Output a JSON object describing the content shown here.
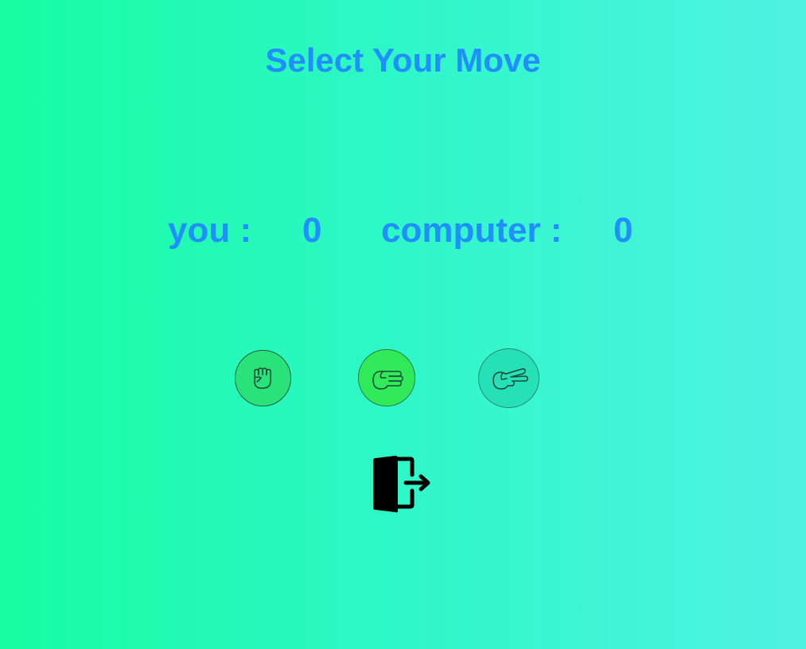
{
  "header": {
    "title": "Select Your Move"
  },
  "score": {
    "you_label": "you :",
    "you_value": "0",
    "computer_label": "computer :",
    "computer_value": "0"
  },
  "moves": [
    {
      "name": "rock",
      "icon": "fist-icon"
    },
    {
      "name": "paper",
      "icon": "open-hand-icon"
    },
    {
      "name": "scissors",
      "icon": "scissors-hand-icon"
    }
  ],
  "exit": {
    "icon": "exit-door-icon"
  },
  "colors": {
    "text_accent": "#1f8eff",
    "bg_left": "#17fca1",
    "bg_right": "#4ff2e2",
    "rock_bg": "#2ae27a",
    "paper_bg": "#30ea5a",
    "scissors_bg": "#26e0b8"
  }
}
